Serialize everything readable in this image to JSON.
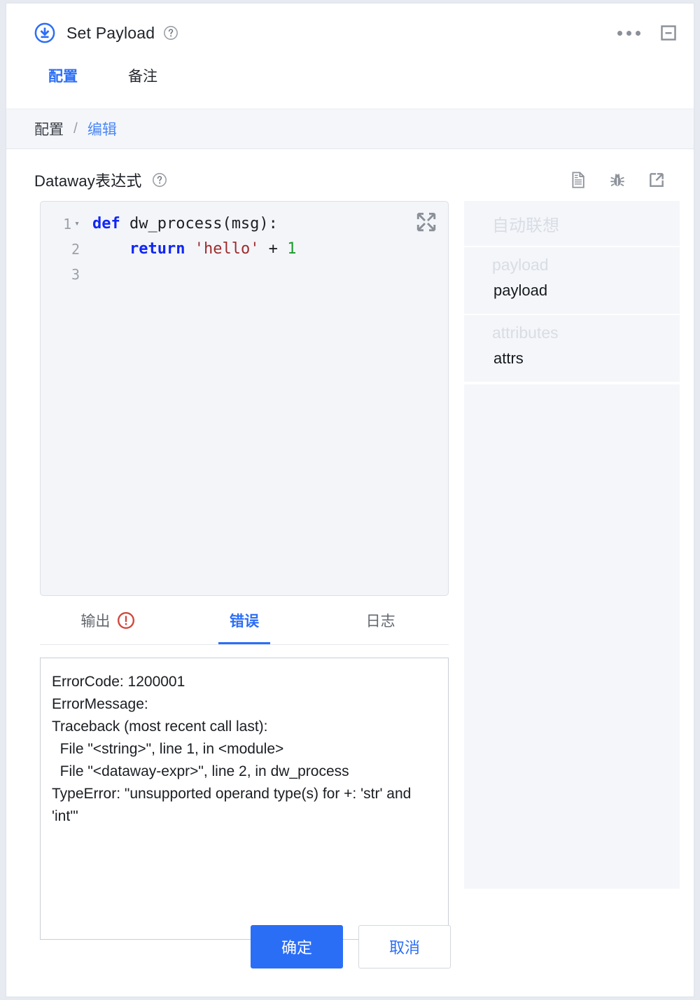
{
  "header": {
    "node_icon": "download-circle-icon",
    "title": "Set Payload",
    "help_icon": "help-circle-icon",
    "more_icon": "more-horizontal-icon",
    "minimize_icon": "minimize-square-icon"
  },
  "tabs": [
    {
      "label": "配置",
      "active": true
    },
    {
      "label": "备注",
      "active": false
    }
  ],
  "breadcrumb": {
    "parent": "配置",
    "separator": "/",
    "current": "编辑"
  },
  "section": {
    "title": "Dataway表达式",
    "help_icon": "help-circle-icon",
    "icons": [
      "document-icon",
      "bug-icon",
      "external-link-icon"
    ]
  },
  "editor": {
    "expand_icon": "collapse-arrows-icon",
    "lines": [
      {
        "number": "1",
        "fold": "▾",
        "tokens": [
          {
            "text": "def",
            "type": "kw"
          },
          {
            "text": " dw_process(msg):",
            "type": "plain"
          }
        ]
      },
      {
        "number": "2",
        "fold": "",
        "tokens": [
          {
            "text": "    ",
            "type": "plain"
          },
          {
            "text": "return",
            "type": "kw"
          },
          {
            "text": " ",
            "type": "plain"
          },
          {
            "text": "'hello'",
            "type": "str"
          },
          {
            "text": " + ",
            "type": "plain"
          },
          {
            "text": "1",
            "type": "num"
          }
        ]
      },
      {
        "number": "3",
        "fold": "",
        "tokens": []
      }
    ]
  },
  "autocomplete": {
    "header": "自动联想",
    "groups": [
      {
        "label": "payload",
        "items": [
          "payload"
        ]
      },
      {
        "label": "attributes",
        "items": [
          "attrs"
        ]
      }
    ]
  },
  "output_tabs": [
    {
      "label": "输出",
      "active": false,
      "badge": "error-circle-icon"
    },
    {
      "label": "错误",
      "active": true,
      "badge": ""
    },
    {
      "label": "日志",
      "active": false,
      "badge": ""
    }
  ],
  "output": {
    "lines": [
      "ErrorCode: 1200001",
      "ErrorMessage:",
      "Traceback (most recent call last):",
      "  File \"<string>\", line 1, in <module>",
      "  File \"<dataway-expr>\", line 2, in dw_process",
      "TypeError: \"unsupported operand type(s) for +: 'str' and 'int'\""
    ]
  },
  "footer": {
    "confirm_label": "确定",
    "cancel_label": "取消"
  },
  "colors": {
    "accent": "#2b6ef6",
    "error": "#d0483f",
    "panel_bg": "#f4f6fa",
    "editor_bg": "#f4f5f9"
  }
}
